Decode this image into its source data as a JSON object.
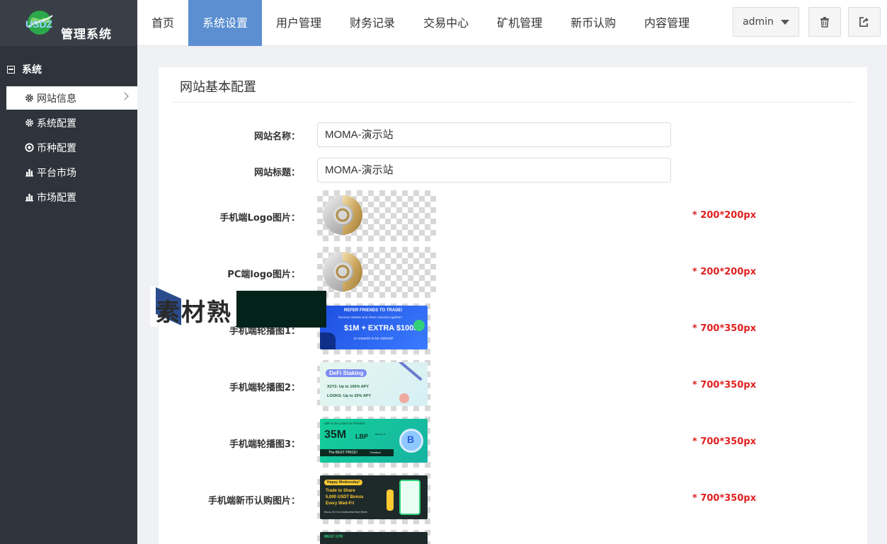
{
  "brand": {
    "logo_text": "USDZ",
    "app_name": "管理系统"
  },
  "nav": [
    {
      "label": "首页",
      "active": false
    },
    {
      "label": "系统设置",
      "active": true
    },
    {
      "label": "用户管理",
      "active": false
    },
    {
      "label": "财务记录",
      "active": false
    },
    {
      "label": "交易中心",
      "active": false
    },
    {
      "label": "矿机管理",
      "active": false
    },
    {
      "label": "新币认购",
      "active": false
    },
    {
      "label": "内容管理",
      "active": false
    }
  ],
  "header": {
    "user_label": "admin",
    "trash_icon": "trash-icon",
    "logout_icon": "logout-icon"
  },
  "sidebar": {
    "group_label": "系统",
    "items": [
      {
        "label": "网站信息",
        "icon": "gear-icon",
        "active": true
      },
      {
        "label": "系统配置",
        "icon": "gear-icon",
        "active": false
      },
      {
        "label": "币种配置",
        "icon": "circle-dot-icon",
        "active": false
      },
      {
        "label": "平台市场",
        "icon": "bar-chart-icon",
        "active": false
      },
      {
        "label": "市场配置",
        "icon": "bar-chart-icon",
        "active": false
      }
    ]
  },
  "panel": {
    "title": "网站基本配置",
    "fields": {
      "site_name_label": "网站名称：",
      "site_name_value": "MOMA-演示站",
      "site_title_label": "网站标题：",
      "site_title_value": "MOMA-演示站"
    },
    "images": [
      {
        "label": "手机端Logo图片：",
        "hint": "* 200*200px"
      },
      {
        "label": "PC端logo图片：",
        "hint": "* 200*200px"
      },
      {
        "label": "手机端轮播图1：",
        "hint": "* 700*350px"
      },
      {
        "label": "手机端轮播图2：",
        "hint": "* 700*350px"
      },
      {
        "label": "手机端轮播图3：",
        "hint": "* 700*350px"
      },
      {
        "label": "手机端新币认购图片：",
        "hint": "* 700*350px"
      }
    ]
  },
  "banners": {
    "b1": {
      "line1": "REFER FRIENDS TO TRADE!",
      "line2": "Receive rebates and share rewards together!",
      "line3": "$1M + EXTRA $100K",
      "line4": "in rewards to be claimed!"
    },
    "b2": {
      "line1": "DeFi Staking",
      "line2": "X2Y2- Up to 100% APY",
      "line3": "LOOKS- Up to 20% APY"
    },
    "b3": {
      "line1": "LBP to be Listed on Primelist",
      "line2": "35M",
      "line3": "LBP",
      "line4": "March 9",
      "line5": "The BEST PRICE!",
      "line6": "7Verified"
    },
    "b4": {
      "line1": "Happy Wednesday!",
      "line2": "Trade to Share",
      "line3": "5,000 USDT Bonus",
      "line4": "Every Wed-Fri",
      "line5": "Bonus 30.0 for Undisturbed Next Week"
    },
    "b5": {
      "line1": "MEXC GTR"
    }
  },
  "watermark": {
    "text": "素材熟"
  },
  "colors": {
    "sidebar_bg": "#2f333b",
    "nav_active": "#5b8fd1",
    "hint_red": "#e02020"
  }
}
